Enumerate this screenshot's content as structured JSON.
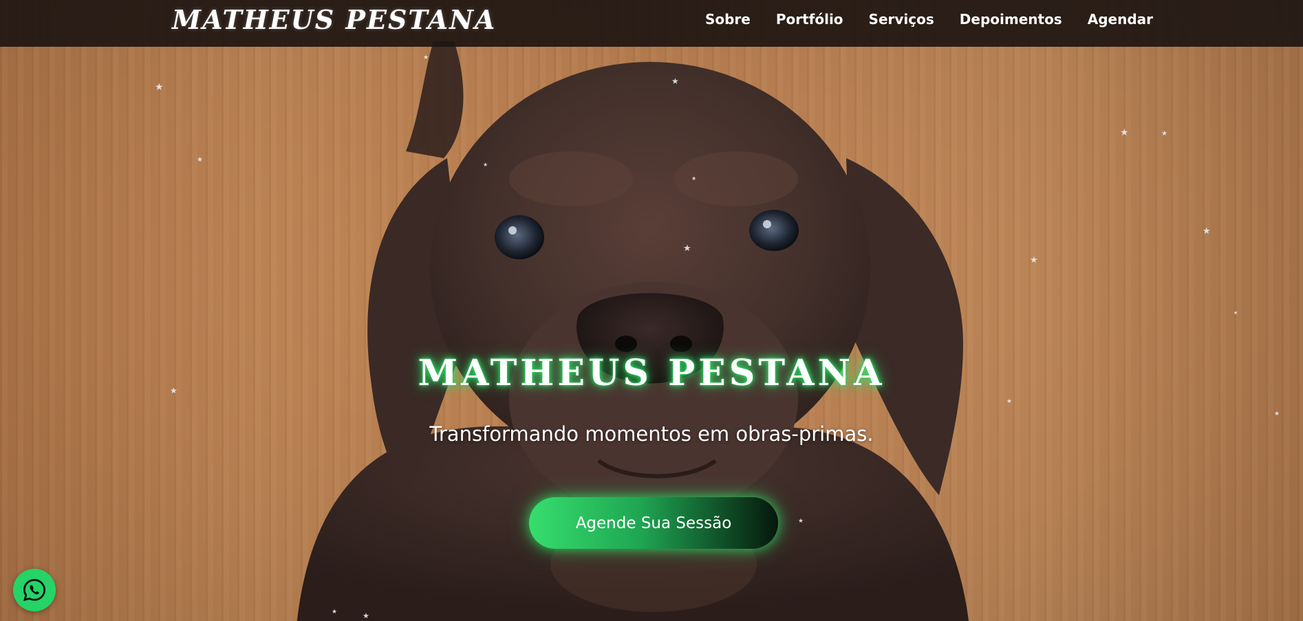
{
  "header": {
    "logo": "MATHEUS PESTANA",
    "nav": [
      {
        "label": "Sobre"
      },
      {
        "label": "Portfólio"
      },
      {
        "label": "Serviços"
      },
      {
        "label": "Depoimentos"
      },
      {
        "label": "Agendar"
      }
    ]
  },
  "hero": {
    "title": "MATHEUS PESTANA",
    "subtitle": "Transformando momentos em obras-primas.",
    "cta_label": "Agende Sua Sessão"
  },
  "colors": {
    "accent_green": "#2ee86a",
    "whatsapp_green": "#25d366",
    "header_bg": "#1e1612"
  },
  "icons": {
    "whatsapp": "whatsapp-icon",
    "star": "star-icon"
  }
}
